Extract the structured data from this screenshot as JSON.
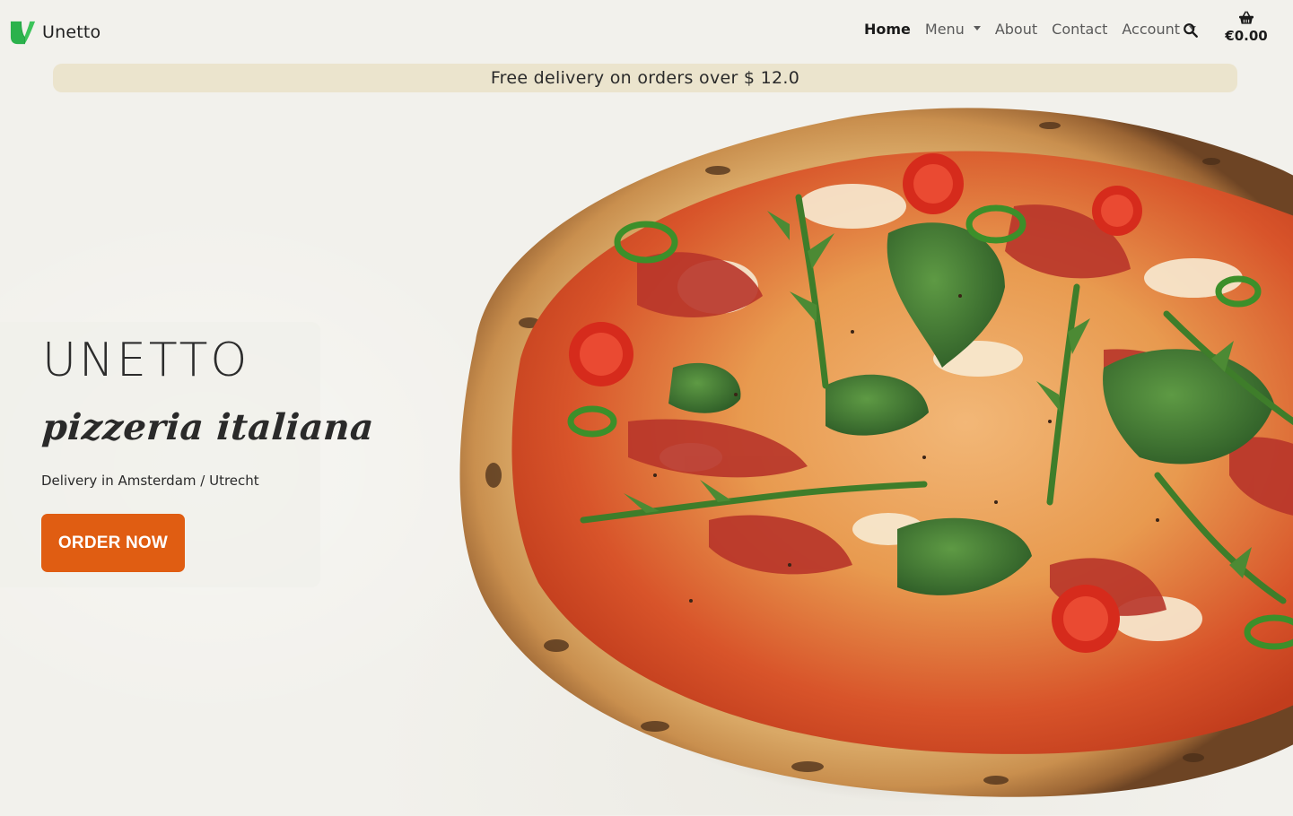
{
  "brand": {
    "name": "Unetto",
    "logo_icon": "unetto-leaf-logo",
    "logo_color": "#2bb24c"
  },
  "nav": {
    "items": [
      {
        "label": "Home",
        "active": true,
        "dropdown": false
      },
      {
        "label": "Menu",
        "active": false,
        "dropdown": true
      },
      {
        "label": "About",
        "active": false,
        "dropdown": false
      },
      {
        "label": "Contact",
        "active": false,
        "dropdown": false
      },
      {
        "label": "Account",
        "active": false,
        "dropdown": true
      }
    ],
    "search_icon": "search-icon",
    "cart": {
      "icon": "basket-icon",
      "total": "€0.00"
    }
  },
  "banner": {
    "text": "Free delivery on orders over $ 12.0",
    "background": "#ebe4cd"
  },
  "hero": {
    "title": "UNETTO",
    "subtitle": "pizzeria italiana",
    "description": "Delivery in Amsterdam / Utrecht",
    "cta_label": "ORDER NOW",
    "cta_color": "#e05d12",
    "image": "pizza-image"
  },
  "colors": {
    "page_background": "#f2f1ec",
    "accent": "#e05d12"
  }
}
